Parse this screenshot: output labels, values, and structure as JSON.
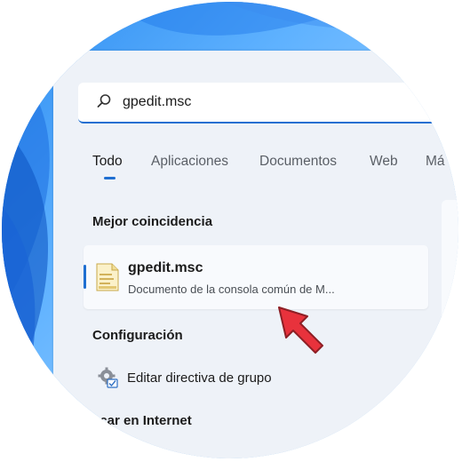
{
  "search": {
    "query": "gpedit.msc"
  },
  "tabs": [
    {
      "label": "Todo",
      "active": true
    },
    {
      "label": "Aplicaciones",
      "active": false
    },
    {
      "label": "Documentos",
      "active": false
    },
    {
      "label": "Web",
      "active": false
    },
    {
      "label": "Má",
      "active": false
    }
  ],
  "sections": {
    "best_match_title": "Mejor coincidencia",
    "settings_title": "Configuración",
    "internet_title": "scar en Internet"
  },
  "best_match": {
    "title": "gpedit.msc",
    "subtitle": "Documento de la consola común de M...",
    "icon": "file-icon"
  },
  "settings_items": [
    {
      "label": "Editar directiva de grupo",
      "icon": "gear-icon"
    }
  ],
  "colors": {
    "accent": "#1f6fd1",
    "panel": "#eef2f8",
    "pointer": "#e8323c"
  }
}
